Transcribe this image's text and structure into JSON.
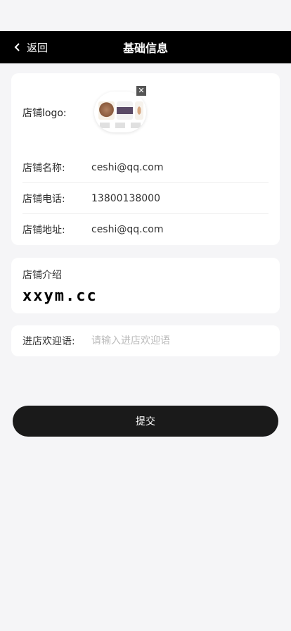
{
  "nav": {
    "back_label": "返回",
    "title": "基础信息"
  },
  "shop": {
    "logo_label": "店铺logo:",
    "fields": [
      {
        "label": "店铺名称:",
        "value": "ceshi@qq.com"
      },
      {
        "label": "店铺电话:",
        "value": "13800138000"
      },
      {
        "label": "店铺地址:",
        "value": "ceshi@qq.com"
      }
    ],
    "intro_label": "店铺介绍",
    "intro_value": "xxym.cc",
    "welcome_label": "进店欢迎语:",
    "welcome_value": "",
    "welcome_placeholder": "请输入进店欢迎语"
  },
  "submit_label": "提交",
  "colors": {
    "nav_bg": "#000000",
    "button_bg": "#1a1a1a",
    "page_bg": "#f5f5f7"
  },
  "icons": [
    "chevron-left-icon",
    "close-icon"
  ]
}
